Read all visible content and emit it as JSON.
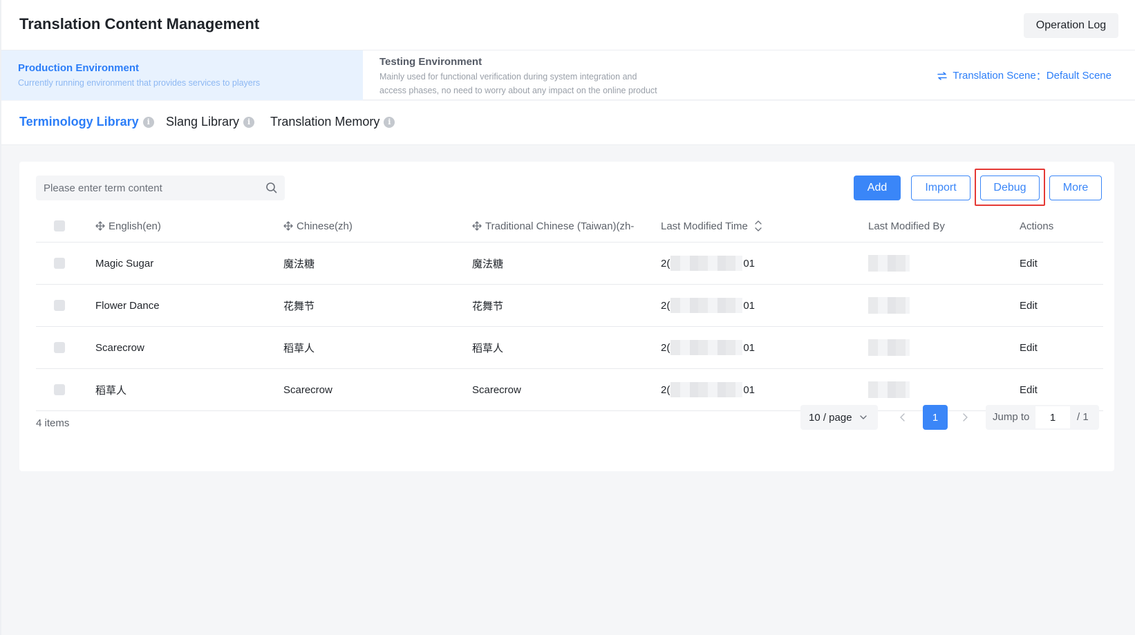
{
  "header": {
    "title": "Translation Content Management",
    "operation_log": "Operation Log"
  },
  "environments": [
    {
      "name": "Production Environment",
      "description": "Currently running environment that provides services to players",
      "active": true
    },
    {
      "name": "Testing Environment",
      "description": "Mainly used for functional verification during system integration and access phases, no need to worry about any impact on the online product",
      "active": false
    }
  ],
  "scene": {
    "label": "Translation Scene",
    "separator": "：",
    "value": "Default Scene"
  },
  "tabs": [
    {
      "label": "Terminology Library",
      "active": true
    },
    {
      "label": "Slang Library",
      "active": false
    },
    {
      "label": "Translation Memory",
      "active": false
    }
  ],
  "search": {
    "placeholder": "Please enter term content"
  },
  "toolbar": {
    "add": "Add",
    "import": "Import",
    "debug": "Debug",
    "more": "More"
  },
  "table": {
    "columns": {
      "english": "English(en)",
      "chinese": "Chinese(zh)",
      "traditional": "Traditional Chinese (Taiwan)(zh-",
      "modified_time": "Last Modified Time",
      "modified_by": "Last Modified By",
      "actions": "Actions"
    },
    "rows": [
      {
        "en": "Magic Sugar",
        "zh": "魔法糖",
        "zh_tw": "魔法糖",
        "time_start": "2(",
        "time_end": "01",
        "action": "Edit"
      },
      {
        "en": "Flower Dance",
        "zh": "花舞节",
        "zh_tw": "花舞节",
        "time_start": "2(",
        "time_end": "01",
        "action": "Edit"
      },
      {
        "en": "Scarecrow",
        "zh": "稻草人",
        "zh_tw": "稻草人",
        "time_start": "2(",
        "time_end": "01",
        "action": "Edit"
      },
      {
        "en": "稻草人",
        "zh": "Scarecrow",
        "zh_tw": "Scarecrow",
        "time_start": "2(",
        "time_end": "01",
        "action": "Edit"
      }
    ]
  },
  "pagination": {
    "count": "4 items",
    "page_size": "10 / page",
    "current_page": "1",
    "jump_label": "Jump to",
    "jump_value": "1",
    "total_pages": "/ 1"
  },
  "colors": {
    "accent": "#3a86f8",
    "highlight": "#e53935"
  }
}
